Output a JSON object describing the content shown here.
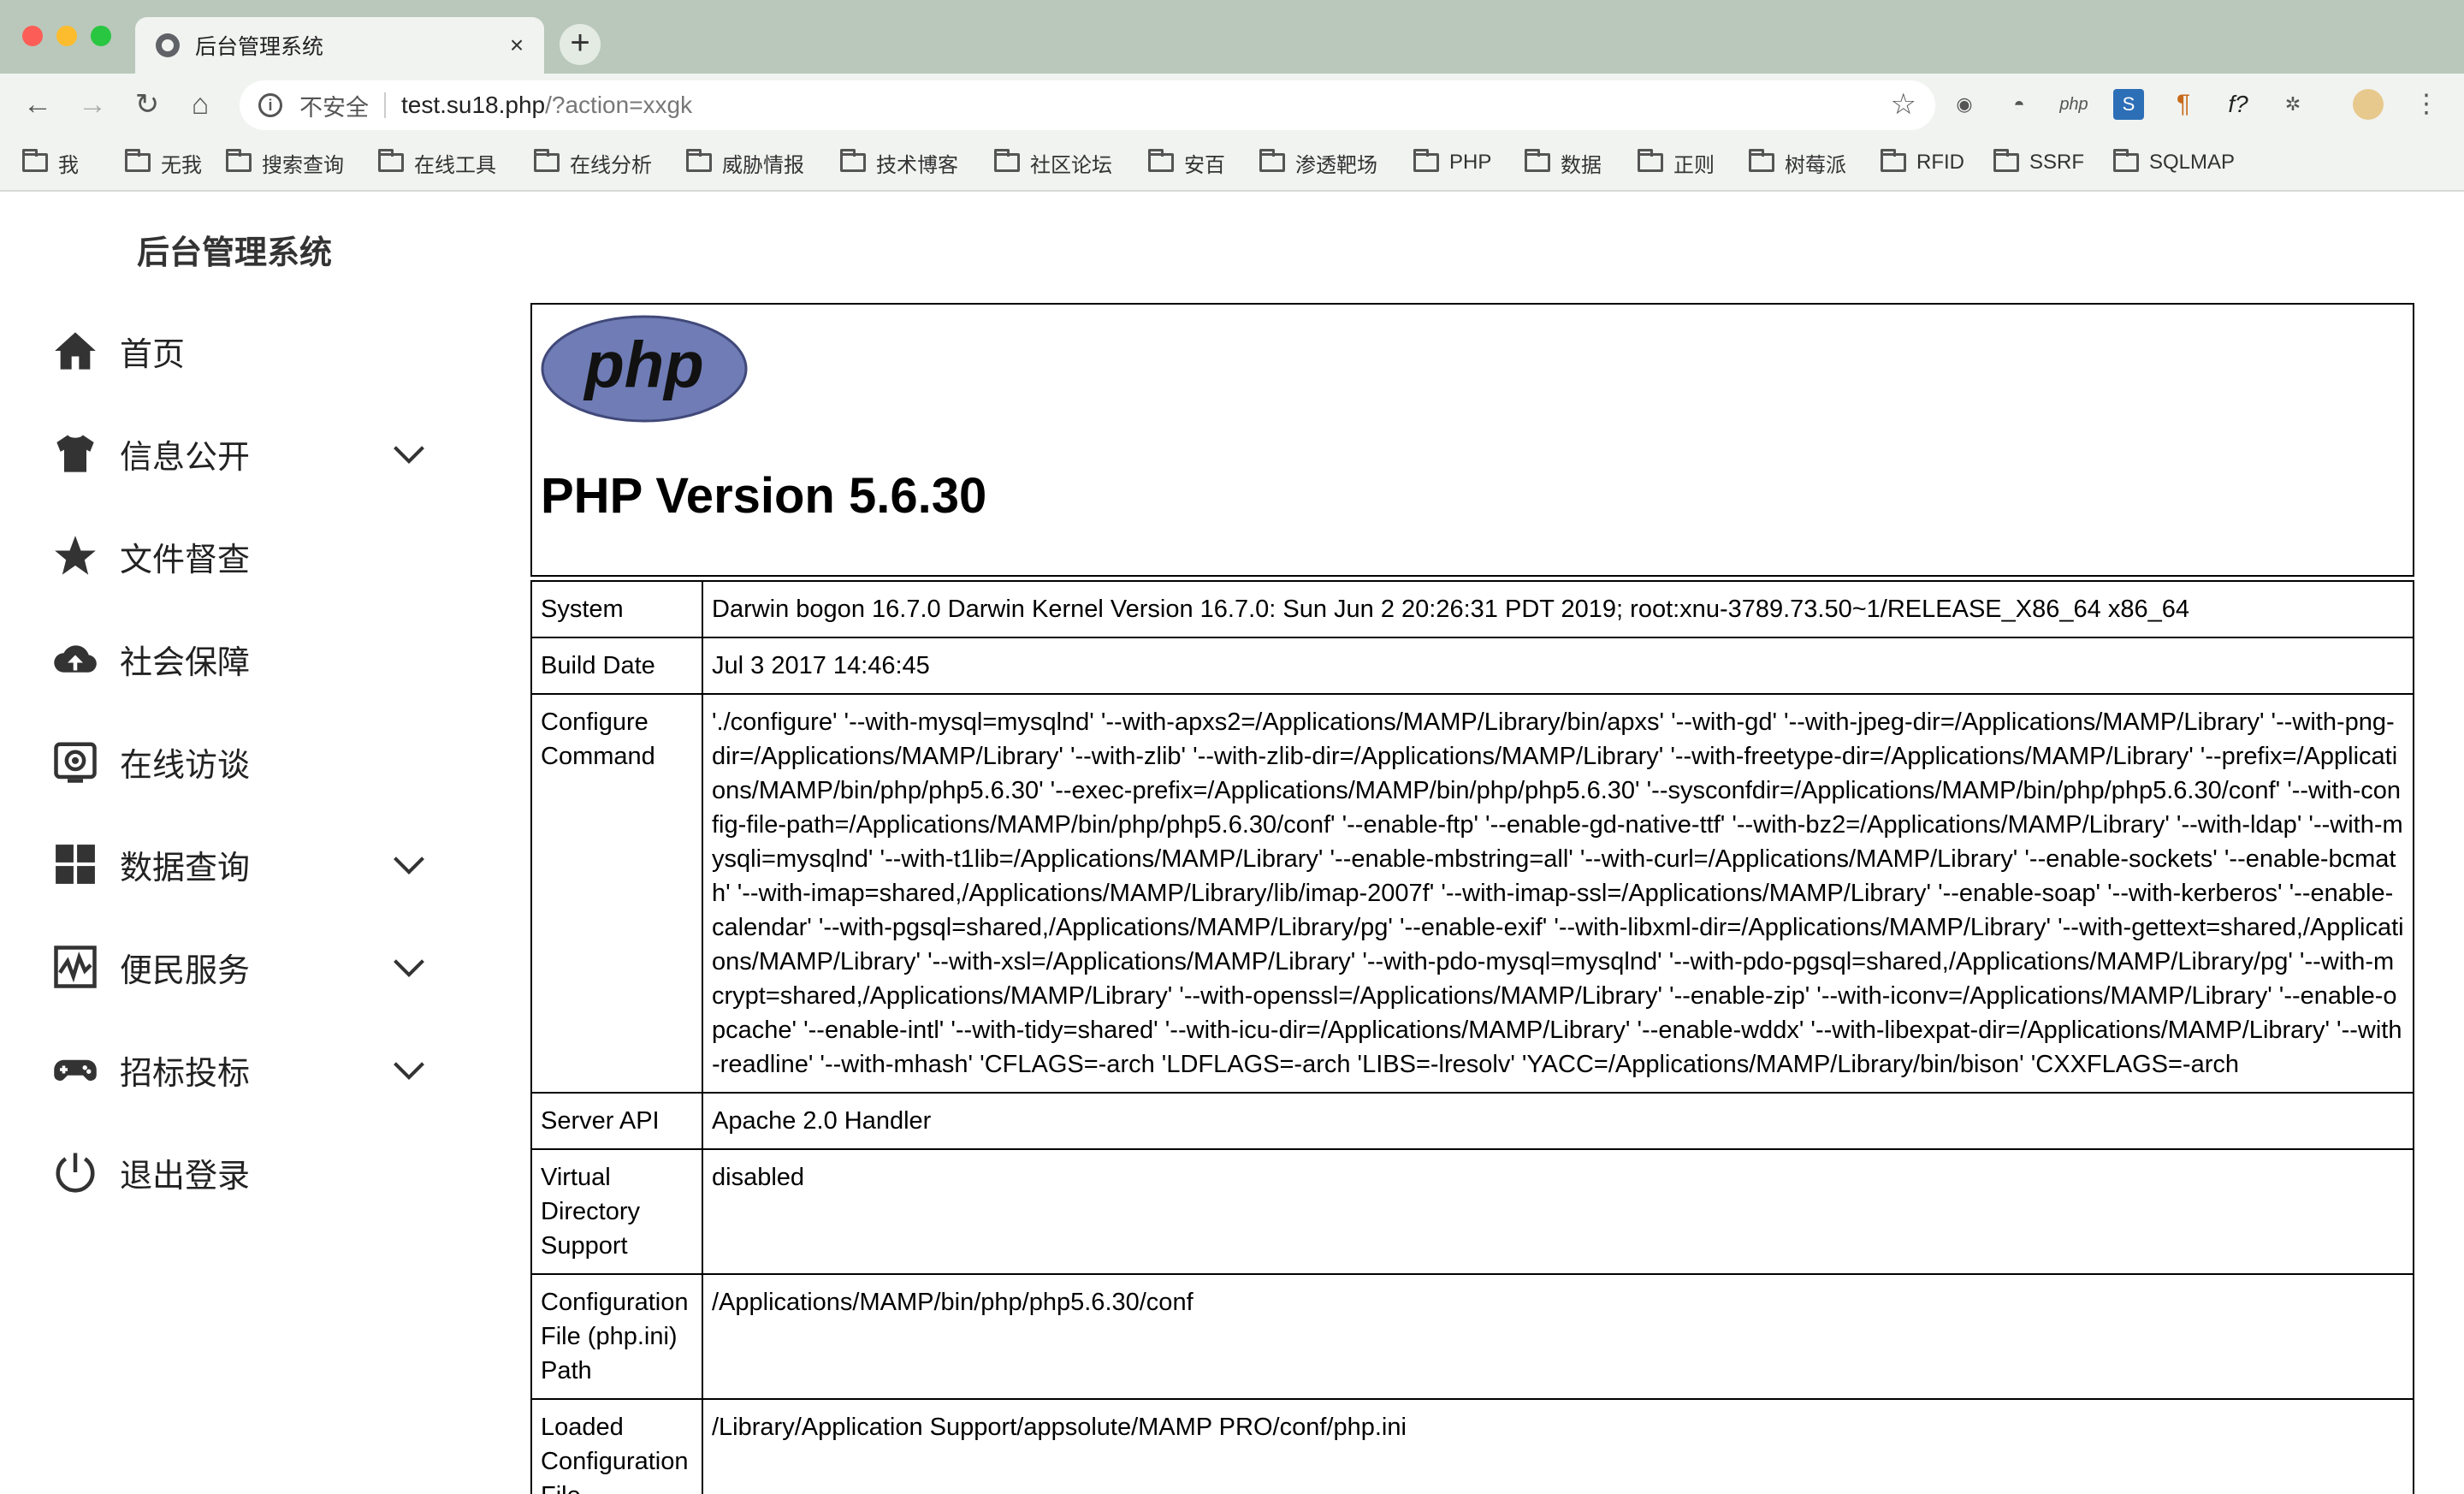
{
  "browser": {
    "tab_title": "后台管理系统",
    "tab_close": "×",
    "new_tab": "+",
    "security_label": "不安全",
    "url_host": "test.su18.php",
    "url_path": "/?action=xxgk",
    "bookmarks": [
      "我",
      "无我",
      "搜索查询",
      "在线工具",
      "在线分析",
      "威胁情报",
      "技术博客",
      "社区论坛",
      "安百",
      "渗透靶场",
      "PHP",
      "数据",
      "正则",
      "树莓派",
      "RFID",
      "SSRF",
      "SQLMAP"
    ],
    "extensions": [
      "record-icon",
      "spy-icon",
      "php-icon",
      "s-icon",
      "pilcrow-icon",
      "f-icon",
      "puzzle-icon",
      "avatar-icon",
      "menu-icon"
    ]
  },
  "sidebar": {
    "brand": "后台管理系统",
    "items": [
      {
        "label": "首页",
        "icon": "home-icon",
        "expandable": false
      },
      {
        "label": "信息公开",
        "icon": "shirt-icon",
        "expandable": true
      },
      {
        "label": "文件督查",
        "icon": "star-icon",
        "expandable": false
      },
      {
        "label": "社会保障",
        "icon": "cloud-upload-icon",
        "expandable": false
      },
      {
        "label": "在线访谈",
        "icon": "camera-icon",
        "expandable": false
      },
      {
        "label": "数据查询",
        "icon": "grid-icon",
        "expandable": true
      },
      {
        "label": "便民服务",
        "icon": "chart-icon",
        "expandable": true
      },
      {
        "label": "招标投标",
        "icon": "gamepad-icon",
        "expandable": true
      },
      {
        "label": "退出登录",
        "icon": "power-icon",
        "expandable": false
      }
    ]
  },
  "phpinfo": {
    "logo_text": "php",
    "version_title": "PHP Version 5.6.30",
    "rows": [
      {
        "key": "System",
        "value": "Darwin bogon 16.7.0 Darwin Kernel Version 16.7.0: Sun Jun 2 20:26:31 PDT 2019; root:xnu-3789.73.50~1/RELEASE_X86_64 x86_64"
      },
      {
        "key": "Build Date",
        "value": "Jul 3 2017 14:46:45"
      },
      {
        "key": "Configure Command",
        "value": "'./configure' '--with-mysql=mysqlnd' '--with-apxs2=/Applications/MAMP/Library/bin/apxs' '--with-gd' '--with-jpeg-dir=/Applications/MAMP/Library' '--with-png-dir=/Applications/MAMP/Library' '--with-zlib' '--with-zlib-dir=/Applications/MAMP/Library' '--with-freetype-dir=/Applications/MAMP/Library' '--prefix=/Applications/MAMP/bin/php/php5.6.30' '--exec-prefix=/Applications/MAMP/bin/php/php5.6.30' '--sysconfdir=/Applications/MAMP/bin/php/php5.6.30/conf' '--with-config-file-path=/Applications/MAMP/bin/php/php5.6.30/conf' '--enable-ftp' '--enable-gd-native-ttf' '--with-bz2=/Applications/MAMP/Library' '--with-ldap' '--with-mysqli=mysqlnd' '--with-t1lib=/Applications/MAMP/Library' '--enable-mbstring=all' '--with-curl=/Applications/MAMP/Library' '--enable-sockets' '--enable-bcmath' '--with-imap=shared,/Applications/MAMP/Library/lib/imap-2007f' '--with-imap-ssl=/Applications/MAMP/Library' '--enable-soap' '--with-kerberos' '--enable-calendar' '--with-pgsql=shared,/Applications/MAMP/Library/pg' '--enable-exif' '--with-libxml-dir=/Applications/MAMP/Library' '--with-gettext=shared,/Applications/MAMP/Library' '--with-xsl=/Applications/MAMP/Library' '--with-pdo-mysql=mysqlnd' '--with-pdo-pgsql=shared,/Applications/MAMP/Library/pg' '--with-mcrypt=shared,/Applications/MAMP/Library' '--with-openssl=/Applications/MAMP/Library' '--enable-zip' '--with-iconv=/Applications/MAMP/Library' '--enable-opcache' '--enable-intl' '--with-tidy=shared' '--with-icu-dir=/Applications/MAMP/Library' '--enable-wddx' '--with-libexpat-dir=/Applications/MAMP/Library' '--with-readline' '--with-mhash' 'CFLAGS=-arch 'LDFLAGS=-arch 'LIBS=-lresolv' 'YACC=/Applications/MAMP/Library/bin/bison' 'CXXFLAGS=-arch"
      },
      {
        "key": "Server API",
        "value": "Apache 2.0 Handler"
      },
      {
        "key": "Virtual Directory Support",
        "value": "disabled"
      },
      {
        "key": "Configuration File (php.ini) Path",
        "value": "/Applications/MAMP/bin/php/php5.6.30/conf"
      },
      {
        "key": "Loaded Configuration File",
        "value": "/Library/Application Support/appsolute/MAMP PRO/conf/php.ini"
      }
    ]
  }
}
